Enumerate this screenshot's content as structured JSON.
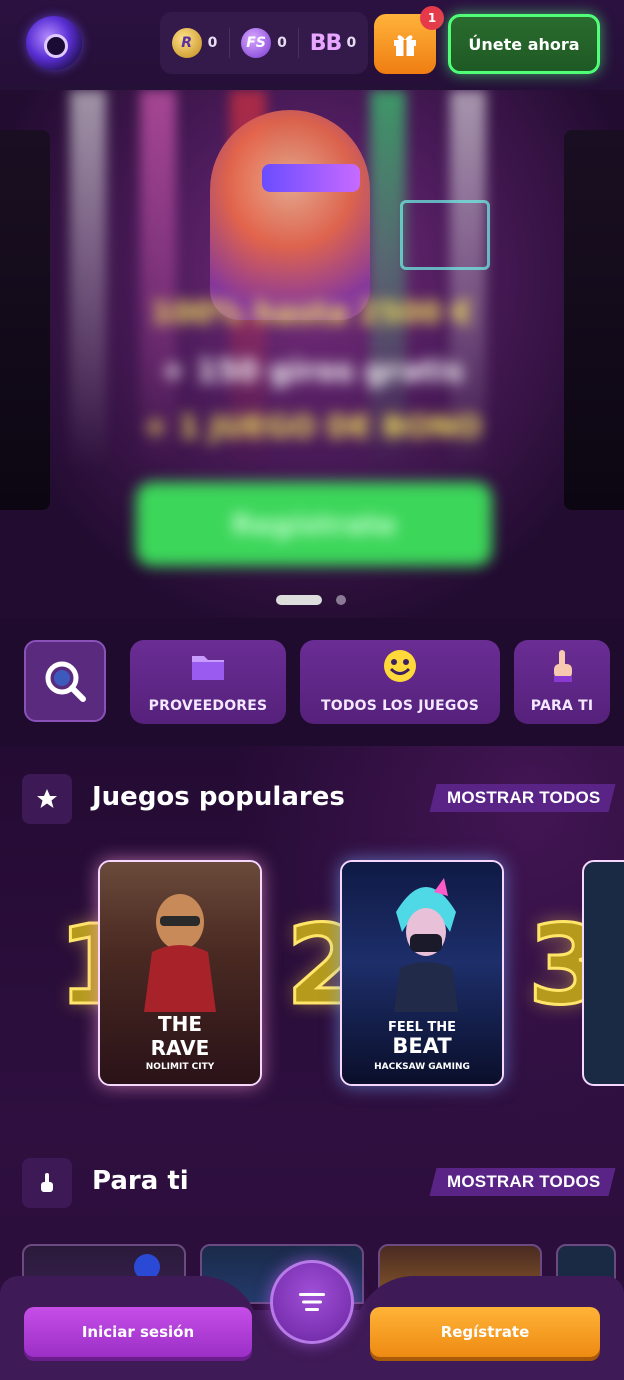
{
  "header": {
    "balances": [
      {
        "icon": "r-coin-icon",
        "label": "R",
        "value": "0"
      },
      {
        "icon": "fs-coin-icon",
        "label": "FS",
        "value": "0"
      },
      {
        "icon": "bb-coin-icon",
        "label": "BB",
        "value": "0"
      }
    ],
    "gift_badge": "1",
    "join_label": "Únete ahora"
  },
  "banner": {
    "line1": "100% hasta 2500 €",
    "line2": "+ 150 giros gratis",
    "line3": "+ 1 JUEGO DE BONO",
    "cta": "Regístrate",
    "slides": 2,
    "active_slide": 1
  },
  "categories": [
    {
      "icon": "folder-icon",
      "label": "PROVEEDORES"
    },
    {
      "icon": "smiley-icon",
      "label": "TODOS LOS JUEGOS"
    },
    {
      "icon": "pointing-hand-icon",
      "label": "PARA TI"
    }
  ],
  "popular": {
    "title": "Juegos populares",
    "show_all": "MOSTRAR TODOS",
    "games": [
      {
        "rank": "1",
        "title_top": "THE",
        "title_bottom": "RAVE",
        "provider": "NOLIMIT CITY"
      },
      {
        "rank": "2",
        "title_top": "FEEL THE",
        "title_bottom": "BEAT",
        "provider": "HACKSAW GAMING"
      },
      {
        "rank": "3"
      }
    ]
  },
  "for_you": {
    "title": "Para ti",
    "show_all": "MOSTRAR TODOS"
  },
  "bottom": {
    "login": "Iniciar sesión",
    "register": "Regístrate"
  },
  "colors": {
    "background": "#1e0b2b",
    "accent_purple": "#5a2487",
    "join_green": "#4eff77",
    "gift_orange": "#ef7d12",
    "rank_gold": "#ffe66a"
  }
}
